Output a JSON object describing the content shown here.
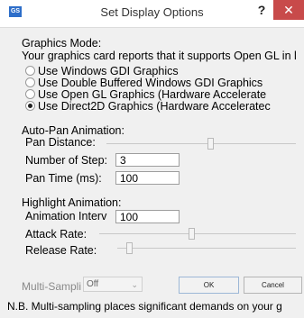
{
  "window": {
    "title": "Set Display Options",
    "app_icon_text": "GS",
    "help_glyph": "?",
    "close_glyph": "✕"
  },
  "graphics": {
    "heading": "Graphics Mode:",
    "support_text": "Your graphics card reports that it supports Open GL in l",
    "options": [
      {
        "label": "Use Windows GDI Graphics",
        "selected": false
      },
      {
        "label": "Use Double Buffered Windows GDI Graphics",
        "selected": false
      },
      {
        "label": "Use Open GL Graphics (Hardware Accelerate",
        "selected": false
      },
      {
        "label": "Use Direct2D Graphics (Hardware Acceleratec",
        "selected": true
      }
    ]
  },
  "autopan": {
    "heading": "Auto-Pan Animation:",
    "distance_label": "Pan Distance:",
    "distance_level": 0.55,
    "steps_label": "Number of Step:",
    "steps_value": "3",
    "time_label": "Pan Time (ms):",
    "time_value": "100"
  },
  "highlight": {
    "heading": "Highlight Animation:",
    "interval_label": "Animation Interv",
    "interval_value": "100",
    "attack_label": "Attack Rate:",
    "attack_level": 0.47,
    "release_label": "Release Rate:",
    "release_level": 0.05
  },
  "footer": {
    "multisampling_label": "Multi-Sampli",
    "multisampling_value": "Off",
    "ok_label": "OK",
    "cancel_label": "Cancel",
    "note": "N.B. Multi-sampling places significant demands on your g"
  }
}
